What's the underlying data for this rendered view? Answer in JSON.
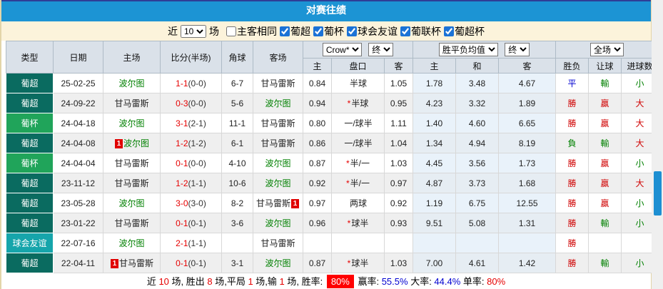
{
  "title": "对赛往绩",
  "filter": {
    "recent_label": "近",
    "count": "10",
    "matches_label": "场",
    "same_venue_label": "主客相同",
    "same_venue_checked": false,
    "leagues": [
      {
        "label": "葡超",
        "checked": true
      },
      {
        "label": "葡杯",
        "checked": true
      },
      {
        "label": "球会友谊",
        "checked": true
      },
      {
        "label": "葡联杯",
        "checked": true
      },
      {
        "label": "葡超杯",
        "checked": true
      }
    ]
  },
  "controls": {
    "company": "Crow*",
    "company_state": "终",
    "avg": "胜平负均值",
    "avg_state": "终",
    "scope": "全场"
  },
  "table": {
    "main_headers": [
      "类型",
      "日期",
      "主场",
      "比分(半场)",
      "角球",
      "客场"
    ],
    "sub_headers": [
      "主",
      "盘口",
      "客",
      "主",
      "和",
      "客",
      "胜负",
      "让球",
      "进球数"
    ],
    "rows": [
      {
        "league": "葡超",
        "league_type": "puchao",
        "date": "25-02-25",
        "home": "波尔图",
        "home_color": "green",
        "home_card_before": "",
        "home_card_after": "",
        "score": "1-1",
        "half": "(0-0)",
        "corner": "6-7",
        "away": "甘马雷斯",
        "away_color": "black",
        "away_card_before": "",
        "away_card_after": "",
        "ah_home": "0.84",
        "handicap_star": "",
        "handicap": "半球",
        "ah_away": "1.05",
        "avg_home": "1.78",
        "avg_draw": "3.48",
        "avg_away": "4.67",
        "result": "平",
        "result_color": "blue",
        "handicap_result": "輸",
        "handicap_result_color": "green",
        "goals": "小",
        "goals_color": "green"
      },
      {
        "league": "葡超",
        "league_type": "puchao",
        "date": "24-09-22",
        "home": "甘马雷斯",
        "home_color": "black",
        "home_card_before": "",
        "home_card_after": "",
        "score": "0-3",
        "half": "(0-0)",
        "corner": "5-6",
        "away": "波尔图",
        "away_color": "green",
        "away_card_before": "",
        "away_card_after": "",
        "ah_home": "0.94",
        "handicap_star": "*",
        "handicap": "半球",
        "ah_away": "0.95",
        "avg_home": "4.23",
        "avg_draw": "3.32",
        "avg_away": "1.89",
        "result": "勝",
        "result_color": "red",
        "handicap_result": "贏",
        "handicap_result_color": "red",
        "goals": "大",
        "goals_color": "red"
      },
      {
        "league": "葡杯",
        "league_type": "pubei",
        "date": "24-04-18",
        "home": "波尔图",
        "home_color": "green",
        "home_card_before": "",
        "home_card_after": "",
        "score": "3-1",
        "half": "(2-1)",
        "corner": "11-1",
        "away": "甘马雷斯",
        "away_color": "black",
        "away_card_before": "",
        "away_card_after": "",
        "ah_home": "0.80",
        "handicap_star": "",
        "handicap": "一/球半",
        "ah_away": "1.11",
        "avg_home": "1.40",
        "avg_draw": "4.60",
        "avg_away": "6.65",
        "result": "勝",
        "result_color": "red",
        "handicap_result": "贏",
        "handicap_result_color": "red",
        "goals": "大",
        "goals_color": "red"
      },
      {
        "league": "葡超",
        "league_type": "puchao",
        "date": "24-04-08",
        "home": "波尔图",
        "home_color": "green",
        "home_card_before": "1",
        "home_card_after": "",
        "score": "1-2",
        "half": "(1-2)",
        "corner": "6-1",
        "away": "甘马雷斯",
        "away_color": "black",
        "away_card_before": "",
        "away_card_after": "",
        "ah_home": "0.86",
        "handicap_star": "",
        "handicap": "一/球半",
        "ah_away": "1.04",
        "avg_home": "1.34",
        "avg_draw": "4.94",
        "avg_away": "8.19",
        "result": "負",
        "result_color": "green",
        "handicap_result": "輸",
        "handicap_result_color": "green",
        "goals": "大",
        "goals_color": "red"
      },
      {
        "league": "葡杯",
        "league_type": "pubei",
        "date": "24-04-04",
        "home": "甘马雷斯",
        "home_color": "black",
        "home_card_before": "",
        "home_card_after": "",
        "score": "0-1",
        "half": "(0-0)",
        "corner": "4-10",
        "away": "波尔图",
        "away_color": "green",
        "away_card_before": "",
        "away_card_after": "",
        "ah_home": "0.87",
        "handicap_star": "*",
        "handicap": "半/一",
        "ah_away": "1.03",
        "avg_home": "4.45",
        "avg_draw": "3.56",
        "avg_away": "1.73",
        "result": "勝",
        "result_color": "red",
        "handicap_result": "贏",
        "handicap_result_color": "red",
        "goals": "小",
        "goals_color": "green"
      },
      {
        "league": "葡超",
        "league_type": "puchao",
        "date": "23-11-12",
        "home": "甘马雷斯",
        "home_color": "black",
        "home_card_before": "",
        "home_card_after": "",
        "score": "1-2",
        "half": "(1-1)",
        "corner": "10-6",
        "away": "波尔图",
        "away_color": "green",
        "away_card_before": "",
        "away_card_after": "",
        "ah_home": "0.92",
        "handicap_star": "*",
        "handicap": "半/一",
        "ah_away": "0.97",
        "avg_home": "4.87",
        "avg_draw": "3.73",
        "avg_away": "1.68",
        "result": "勝",
        "result_color": "red",
        "handicap_result": "贏",
        "handicap_result_color": "red",
        "goals": "大",
        "goals_color": "red"
      },
      {
        "league": "葡超",
        "league_type": "puchao",
        "date": "23-05-28",
        "home": "波尔图",
        "home_color": "green",
        "home_card_before": "",
        "home_card_after": "",
        "score": "3-0",
        "half": "(3-0)",
        "corner": "8-2",
        "away": "甘马雷斯",
        "away_color": "black",
        "away_card_before": "",
        "away_card_after": "1",
        "ah_home": "0.97",
        "handicap_star": "",
        "handicap": "两球",
        "ah_away": "0.92",
        "avg_home": "1.19",
        "avg_draw": "6.75",
        "avg_away": "12.55",
        "result": "勝",
        "result_color": "red",
        "handicap_result": "贏",
        "handicap_result_color": "red",
        "goals": "小",
        "goals_color": "green"
      },
      {
        "league": "葡超",
        "league_type": "puchao",
        "date": "23-01-22",
        "home": "甘马雷斯",
        "home_color": "black",
        "home_card_before": "",
        "home_card_after": "",
        "score": "0-1",
        "half": "(0-1)",
        "corner": "3-6",
        "away": "波尔图",
        "away_color": "green",
        "away_card_before": "",
        "away_card_after": "",
        "ah_home": "0.96",
        "handicap_star": "*",
        "handicap": "球半",
        "ah_away": "0.93",
        "avg_home": "9.51",
        "avg_draw": "5.08",
        "avg_away": "1.31",
        "result": "勝",
        "result_color": "red",
        "handicap_result": "輸",
        "handicap_result_color": "green",
        "goals": "小",
        "goals_color": "green"
      },
      {
        "league": "球会友谊",
        "league_type": "friendly",
        "date": "22-07-16",
        "home": "波尔图",
        "home_color": "green",
        "home_card_before": "",
        "home_card_after": "",
        "score": "2-1",
        "half": "(1-1)",
        "corner": "",
        "away": "甘马雷斯",
        "away_color": "black",
        "away_card_before": "",
        "away_card_after": "",
        "ah_home": "",
        "handicap_star": "",
        "handicap": "",
        "ah_away": "",
        "avg_home": "",
        "avg_draw": "",
        "avg_away": "",
        "result": "勝",
        "result_color": "red",
        "handicap_result": "",
        "handicap_result_color": "",
        "goals": "",
        "goals_color": ""
      },
      {
        "league": "葡超",
        "league_type": "puchao",
        "date": "22-04-11",
        "home": "甘马雷斯",
        "home_color": "black",
        "home_card_before": "1",
        "home_card_after": "",
        "score": "0-1",
        "half": "(0-1)",
        "corner": "3-1",
        "away": "波尔图",
        "away_color": "green",
        "away_card_before": "",
        "away_card_after": "",
        "ah_home": "0.87",
        "handicap_star": "*",
        "handicap": "球半",
        "ah_away": "1.03",
        "avg_home": "7.00",
        "avg_draw": "4.61",
        "avg_away": "1.42",
        "result": "勝",
        "result_color": "red",
        "handicap_result": "輸",
        "handicap_result_color": "green",
        "goals": "小",
        "goals_color": "green"
      }
    ]
  },
  "summary": [
    {
      "text": "近 ",
      "style": "k"
    },
    {
      "text": "10",
      "style": "r"
    },
    {
      "text": " 场, 胜出 ",
      "style": "k"
    },
    {
      "text": "8",
      "style": "r"
    },
    {
      "text": " 场,平局 ",
      "style": "k"
    },
    {
      "text": "1",
      "style": "r"
    },
    {
      "text": " 场,输 ",
      "style": "k"
    },
    {
      "text": "1",
      "style": "r"
    },
    {
      "text": " 场, 胜率: ",
      "style": "k"
    },
    {
      "text": "80%",
      "style": "badge"
    },
    {
      "text": " 赢率: ",
      "style": "k"
    },
    {
      "text": "55.5%",
      "style": "b"
    },
    {
      "text": " 大率: ",
      "style": "k"
    },
    {
      "text": "44.4%",
      "style": "b"
    },
    {
      "text": " 单率: ",
      "style": "k"
    },
    {
      "text": "80%",
      "style": "r"
    }
  ],
  "colors": {
    "title_bar": "#1C94D4",
    "filter_bg": "#FCF3DB",
    "league_puchao": "#0A6B60",
    "league_pubei": "#20A45A",
    "league_friendly": "#16A5AB",
    "win_red": "#D00000",
    "draw_blue": "#0000D0",
    "loss_green": "#008000",
    "scroll_thumb": "#1D8FD2"
  }
}
